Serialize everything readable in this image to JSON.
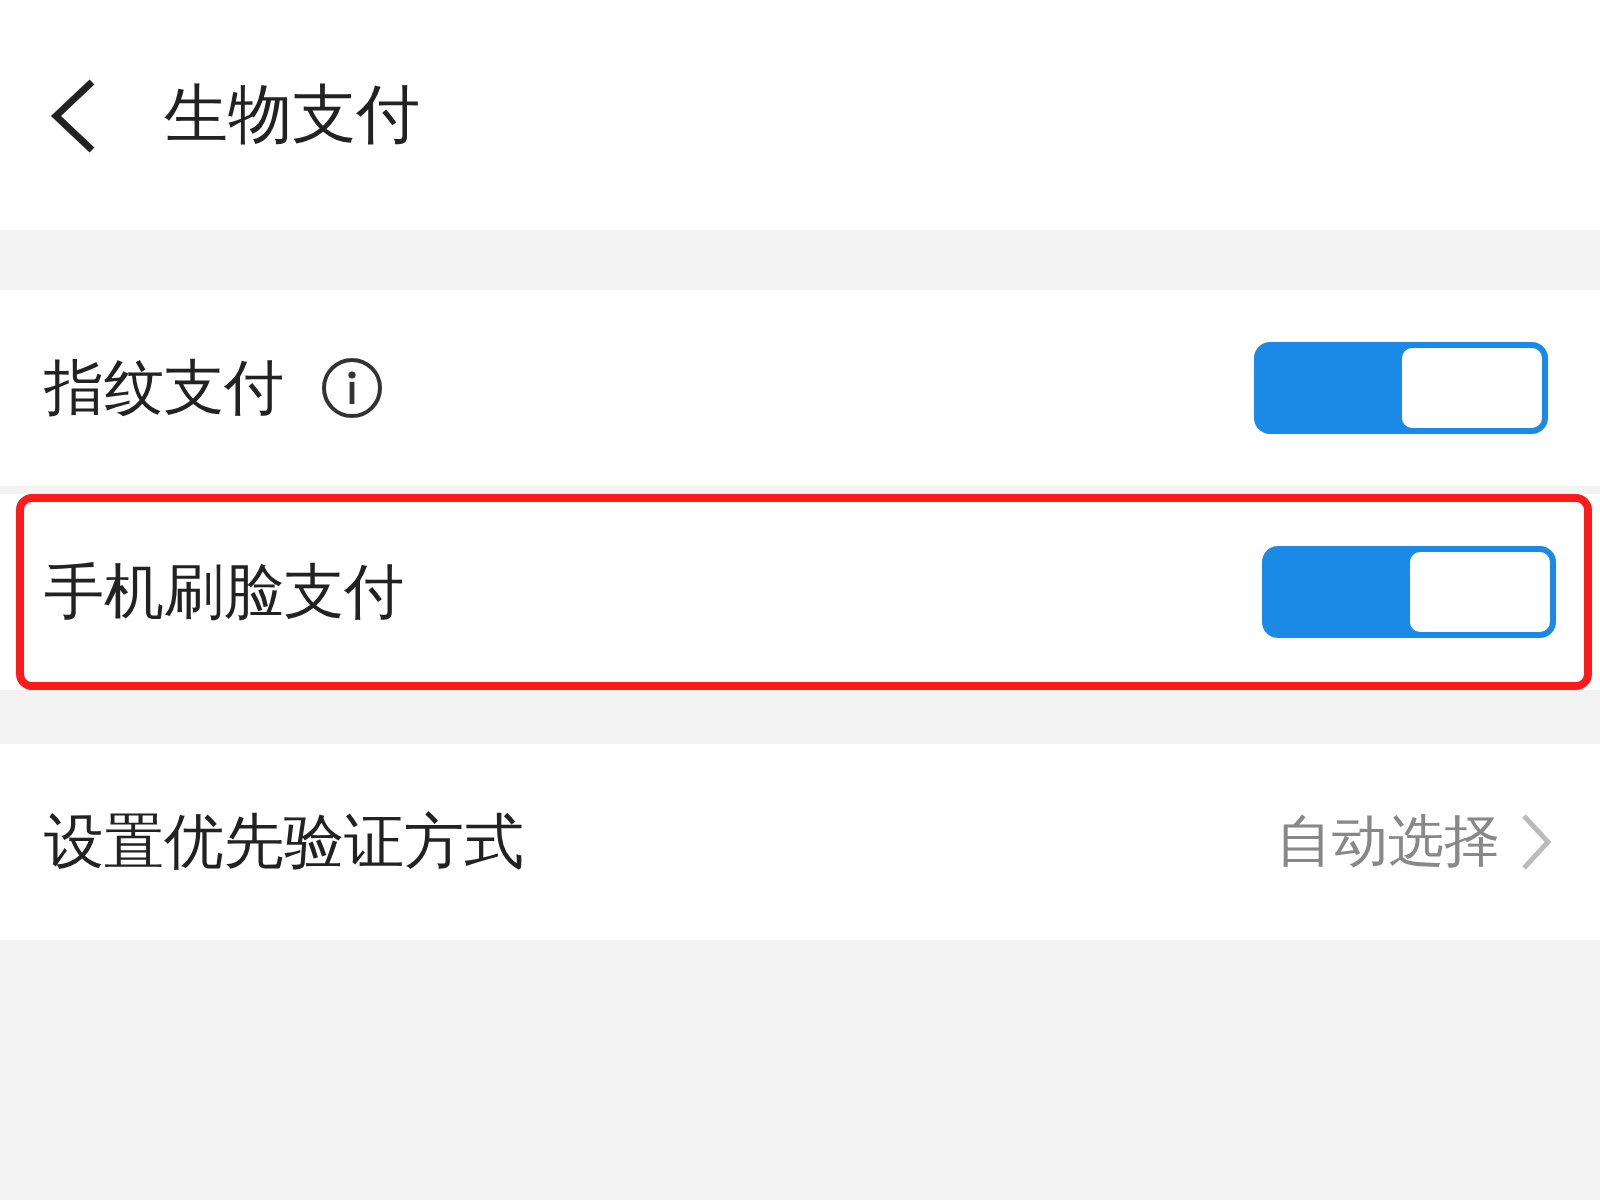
{
  "header": {
    "title": "生物支付"
  },
  "toggle_rows": [
    {
      "label": "指纹支付",
      "info": true,
      "on": true,
      "highlighted": false
    },
    {
      "label": "手机刷脸支付",
      "info": false,
      "on": true,
      "highlighted": true
    }
  ],
  "option_row": {
    "label": "设置优先验证方式",
    "value": "自动选择"
  }
}
